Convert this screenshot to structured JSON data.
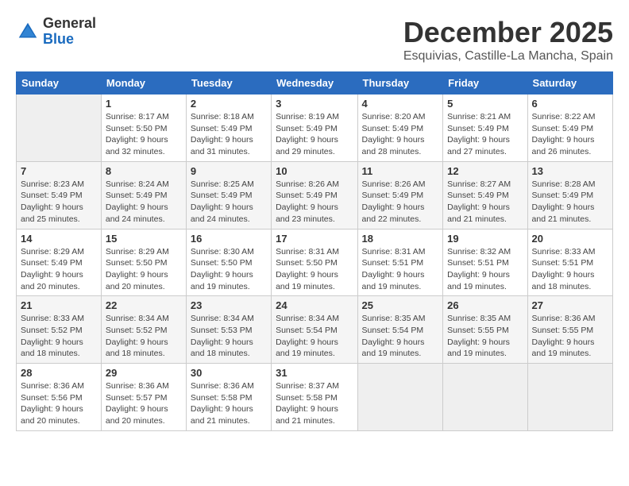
{
  "logo": {
    "general": "General",
    "blue": "Blue"
  },
  "title": "December 2025",
  "subtitle": "Esquivias, Castille-La Mancha, Spain",
  "headers": [
    "Sunday",
    "Monday",
    "Tuesday",
    "Wednesday",
    "Thursday",
    "Friday",
    "Saturday"
  ],
  "weeks": [
    [
      {
        "day": "",
        "info": ""
      },
      {
        "day": "1",
        "info": "Sunrise: 8:17 AM\nSunset: 5:50 PM\nDaylight: 9 hours\nand 32 minutes."
      },
      {
        "day": "2",
        "info": "Sunrise: 8:18 AM\nSunset: 5:49 PM\nDaylight: 9 hours\nand 31 minutes."
      },
      {
        "day": "3",
        "info": "Sunrise: 8:19 AM\nSunset: 5:49 PM\nDaylight: 9 hours\nand 29 minutes."
      },
      {
        "day": "4",
        "info": "Sunrise: 8:20 AM\nSunset: 5:49 PM\nDaylight: 9 hours\nand 28 minutes."
      },
      {
        "day": "5",
        "info": "Sunrise: 8:21 AM\nSunset: 5:49 PM\nDaylight: 9 hours\nand 27 minutes."
      },
      {
        "day": "6",
        "info": "Sunrise: 8:22 AM\nSunset: 5:49 PM\nDaylight: 9 hours\nand 26 minutes."
      }
    ],
    [
      {
        "day": "7",
        "info": "Sunrise: 8:23 AM\nSunset: 5:49 PM\nDaylight: 9 hours\nand 25 minutes."
      },
      {
        "day": "8",
        "info": "Sunrise: 8:24 AM\nSunset: 5:49 PM\nDaylight: 9 hours\nand 24 minutes."
      },
      {
        "day": "9",
        "info": "Sunrise: 8:25 AM\nSunset: 5:49 PM\nDaylight: 9 hours\nand 24 minutes."
      },
      {
        "day": "10",
        "info": "Sunrise: 8:26 AM\nSunset: 5:49 PM\nDaylight: 9 hours\nand 23 minutes."
      },
      {
        "day": "11",
        "info": "Sunrise: 8:26 AM\nSunset: 5:49 PM\nDaylight: 9 hours\nand 22 minutes."
      },
      {
        "day": "12",
        "info": "Sunrise: 8:27 AM\nSunset: 5:49 PM\nDaylight: 9 hours\nand 21 minutes."
      },
      {
        "day": "13",
        "info": "Sunrise: 8:28 AM\nSunset: 5:49 PM\nDaylight: 9 hours\nand 21 minutes."
      }
    ],
    [
      {
        "day": "14",
        "info": "Sunrise: 8:29 AM\nSunset: 5:49 PM\nDaylight: 9 hours\nand 20 minutes."
      },
      {
        "day": "15",
        "info": "Sunrise: 8:29 AM\nSunset: 5:50 PM\nDaylight: 9 hours\nand 20 minutes."
      },
      {
        "day": "16",
        "info": "Sunrise: 8:30 AM\nSunset: 5:50 PM\nDaylight: 9 hours\nand 19 minutes."
      },
      {
        "day": "17",
        "info": "Sunrise: 8:31 AM\nSunset: 5:50 PM\nDaylight: 9 hours\nand 19 minutes."
      },
      {
        "day": "18",
        "info": "Sunrise: 8:31 AM\nSunset: 5:51 PM\nDaylight: 9 hours\nand 19 minutes."
      },
      {
        "day": "19",
        "info": "Sunrise: 8:32 AM\nSunset: 5:51 PM\nDaylight: 9 hours\nand 19 minutes."
      },
      {
        "day": "20",
        "info": "Sunrise: 8:33 AM\nSunset: 5:51 PM\nDaylight: 9 hours\nand 18 minutes."
      }
    ],
    [
      {
        "day": "21",
        "info": "Sunrise: 8:33 AM\nSunset: 5:52 PM\nDaylight: 9 hours\nand 18 minutes."
      },
      {
        "day": "22",
        "info": "Sunrise: 8:34 AM\nSunset: 5:52 PM\nDaylight: 9 hours\nand 18 minutes."
      },
      {
        "day": "23",
        "info": "Sunrise: 8:34 AM\nSunset: 5:53 PM\nDaylight: 9 hours\nand 18 minutes."
      },
      {
        "day": "24",
        "info": "Sunrise: 8:34 AM\nSunset: 5:54 PM\nDaylight: 9 hours\nand 19 minutes."
      },
      {
        "day": "25",
        "info": "Sunrise: 8:35 AM\nSunset: 5:54 PM\nDaylight: 9 hours\nand 19 minutes."
      },
      {
        "day": "26",
        "info": "Sunrise: 8:35 AM\nSunset: 5:55 PM\nDaylight: 9 hours\nand 19 minutes."
      },
      {
        "day": "27",
        "info": "Sunrise: 8:36 AM\nSunset: 5:55 PM\nDaylight: 9 hours\nand 19 minutes."
      }
    ],
    [
      {
        "day": "28",
        "info": "Sunrise: 8:36 AM\nSunset: 5:56 PM\nDaylight: 9 hours\nand 20 minutes."
      },
      {
        "day": "29",
        "info": "Sunrise: 8:36 AM\nSunset: 5:57 PM\nDaylight: 9 hours\nand 20 minutes."
      },
      {
        "day": "30",
        "info": "Sunrise: 8:36 AM\nSunset: 5:58 PM\nDaylight: 9 hours\nand 21 minutes."
      },
      {
        "day": "31",
        "info": "Sunrise: 8:37 AM\nSunset: 5:58 PM\nDaylight: 9 hours\nand 21 minutes."
      },
      {
        "day": "",
        "info": ""
      },
      {
        "day": "",
        "info": ""
      },
      {
        "day": "",
        "info": ""
      }
    ]
  ]
}
